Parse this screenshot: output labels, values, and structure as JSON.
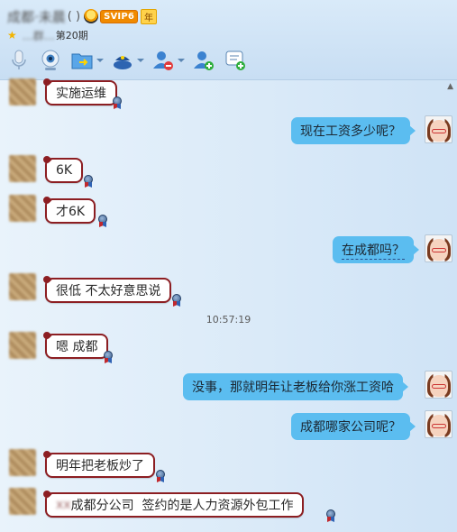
{
  "header": {
    "contact_name": "成都·未晨",
    "contact_id": "(         )",
    "vip_label": "SVIP6",
    "vip_year": "年",
    "signature_blurred": "…群…",
    "signature_tail": "第20期"
  },
  "toolbar": {
    "items": [
      {
        "icon": "microphone-icon"
      },
      {
        "icon": "webcam-icon"
      },
      {
        "icon": "send-file-icon"
      },
      {
        "icon": "remote-assist-icon"
      },
      {
        "icon": "remove-contact-icon"
      },
      {
        "icon": "add-contact-icon"
      },
      {
        "icon": "app-box-icon"
      }
    ]
  },
  "colors": {
    "left_bubble_border": "#8c1e22",
    "right_bubble_fill": "#5bbdf0",
    "chat_background": "#d9eaf8"
  },
  "messages": [
    {
      "side": "left",
      "text": "实施运维"
    },
    {
      "side": "right",
      "text": "现在工资多少呢？"
    },
    {
      "side": "left",
      "text": "6K"
    },
    {
      "side": "left",
      "text": "才6K"
    },
    {
      "side": "right",
      "text": "在成都吗？"
    },
    {
      "side": "left",
      "text": "很低 不太好意思说"
    },
    {
      "side": "time",
      "text": "10:57:19"
    },
    {
      "side": "left",
      "text": "嗯 成都"
    },
    {
      "side": "right",
      "text": "没事，那就明年让老板给你涨工资哈"
    },
    {
      "side": "right",
      "text": "成都哪家公司呢？"
    },
    {
      "side": "left",
      "text": "明年把老板炒了"
    },
    {
      "side": "left",
      "text_blurred": "xx",
      "text": "成都分公司  签约的是人力资源外包工作"
    }
  ]
}
